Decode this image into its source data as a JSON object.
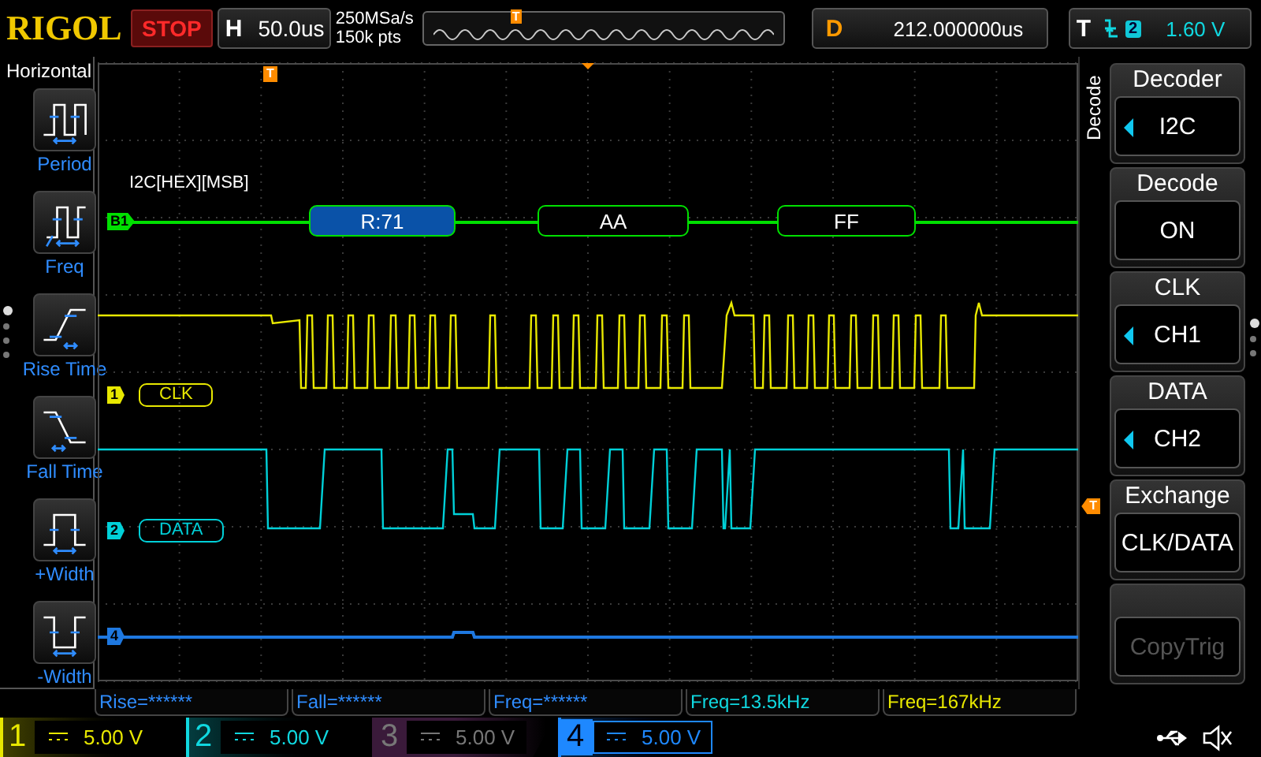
{
  "brand": "RIGOL",
  "run_state": "STOP",
  "timebase": {
    "label": "H",
    "value": "50.0us"
  },
  "acquisition": {
    "sample_rate": "250MSa/s",
    "memory_depth": "150k pts"
  },
  "overview": {
    "trigger_marker": "T"
  },
  "delay": {
    "label": "D",
    "value": "212.000000us"
  },
  "trigger": {
    "label": "T",
    "source": "2",
    "level": "1.60 V"
  },
  "left_menu": {
    "title": "Horizontal",
    "pages": [
      {
        "selected": true
      },
      {
        "selected": false
      },
      {
        "selected": false
      },
      {
        "selected": false
      }
    ],
    "items": [
      {
        "label": "Period",
        "kind": "period"
      },
      {
        "label": "Freq",
        "kind": "freq"
      },
      {
        "label": "Rise Time",
        "kind": "rise"
      },
      {
        "label": "Fall Time",
        "kind": "fall"
      },
      {
        "label": "+Width",
        "kind": "pwidth"
      },
      {
        "label": "-Width",
        "kind": "nwidth"
      }
    ]
  },
  "screen": {
    "bus_label": "I2C[HEX][MSB]",
    "bus_marker": "B1",
    "trigger_position_marker": "T",
    "trigger_level_marker": "T",
    "packets": [
      {
        "text": "R:71",
        "kind": "address"
      },
      {
        "text": "AA",
        "kind": "data"
      },
      {
        "text": "FF",
        "kind": "data"
      }
    ],
    "channels": [
      {
        "marker": "1",
        "label": "CLK",
        "color": "#e8e800",
        "kind": "clk"
      },
      {
        "marker": "2",
        "label": "DATA",
        "color": "#00d0d8",
        "kind": "data"
      },
      {
        "marker": "4",
        "color": "#1e78e0",
        "kind": "flat"
      }
    ]
  },
  "right_menu": {
    "title": "Decode",
    "pages": [
      {
        "selected": true
      },
      {
        "selected": false
      },
      {
        "selected": false
      }
    ],
    "items": [
      {
        "header": "Decoder",
        "value": "I2C",
        "selectable": true,
        "disabled": false
      },
      {
        "header": "Decode",
        "value": "ON",
        "selectable": false,
        "disabled": false
      },
      {
        "header": "CLK",
        "value": "CH1",
        "selectable": true,
        "disabled": false
      },
      {
        "header": "DATA",
        "value": "CH2",
        "selectable": true,
        "disabled": false
      },
      {
        "header": "Exchange",
        "value": "CLK/DATA",
        "selectable": false,
        "disabled": false
      },
      {
        "value": "CopyTrig",
        "selectable": false,
        "disabled": true
      }
    ]
  },
  "measurements": [
    {
      "text": "Rise=******",
      "color": "#2f8cff"
    },
    {
      "text": "Fall=******",
      "color": "#2f8cff"
    },
    {
      "text": "Freq=******",
      "color": "#2f8cff"
    },
    {
      "text": "Freq=13.5kHz",
      "color": "#10d8e0"
    },
    {
      "text": "Freq=167kHz",
      "color": "#e8e800"
    }
  ],
  "channel_bar": [
    {
      "number": "1",
      "scale": "5.00 V",
      "color": "#e8e800",
      "on": true,
      "selected": false
    },
    {
      "number": "2",
      "scale": "5.00 V",
      "color": "#10d8e0",
      "on": true,
      "selected": false
    },
    {
      "number": "3",
      "scale": "5.00 V",
      "color": "#3a1a3a",
      "on": false,
      "selected": false
    },
    {
      "number": "4",
      "scale": "5.00 V",
      "color": "#1e88ff",
      "on": true,
      "selected": true
    }
  ]
}
